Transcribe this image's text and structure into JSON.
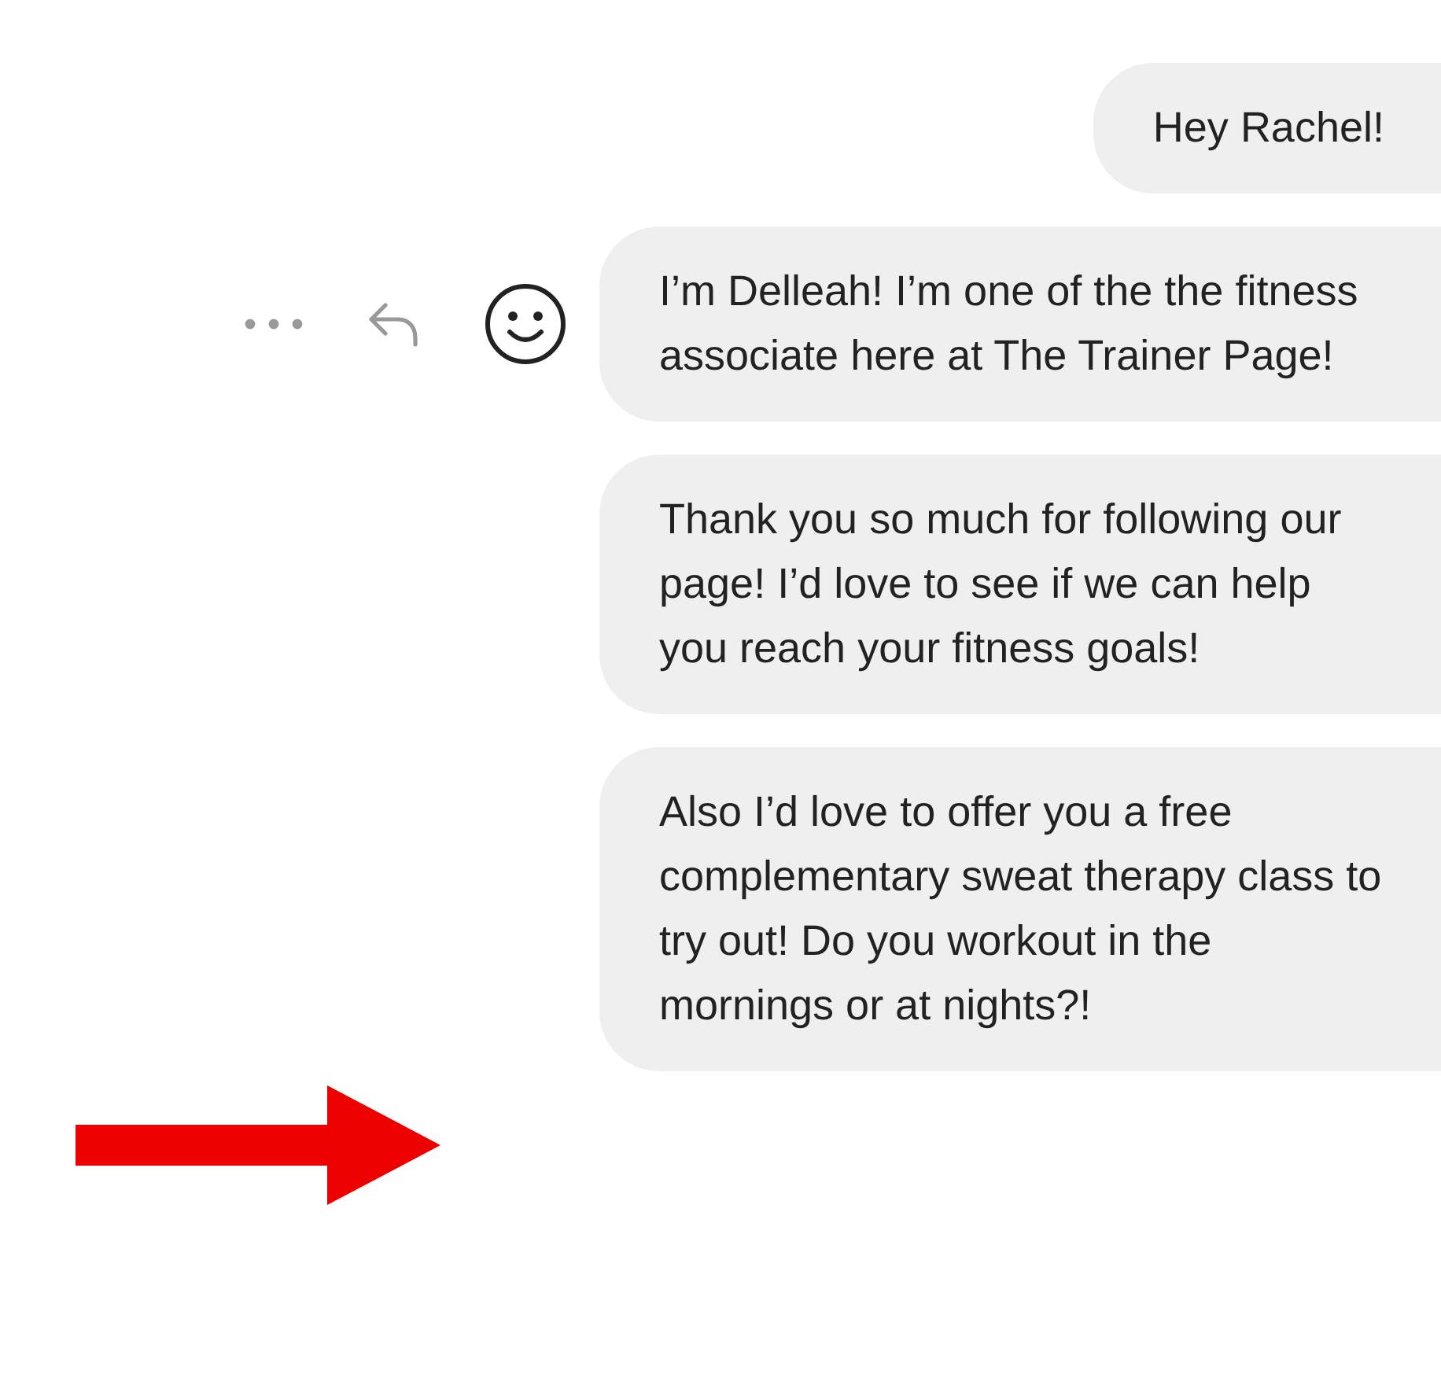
{
  "messages": [
    {
      "text": "Hey Rachel!",
      "actions_shown": false
    },
    {
      "text": "I’m Delleah! I’m one of the the fitness associate here at The Trainer Page!",
      "actions_shown": true
    },
    {
      "text": "Thank you so much for following our page! I’d love to see if we can help you reach your fitness goals!",
      "actions_shown": false
    },
    {
      "text": "Also I’d love to offer you a free complementary sweat therapy class to try out! Do you workout in the mornings or at nights?!",
      "actions_shown": false
    }
  ]
}
